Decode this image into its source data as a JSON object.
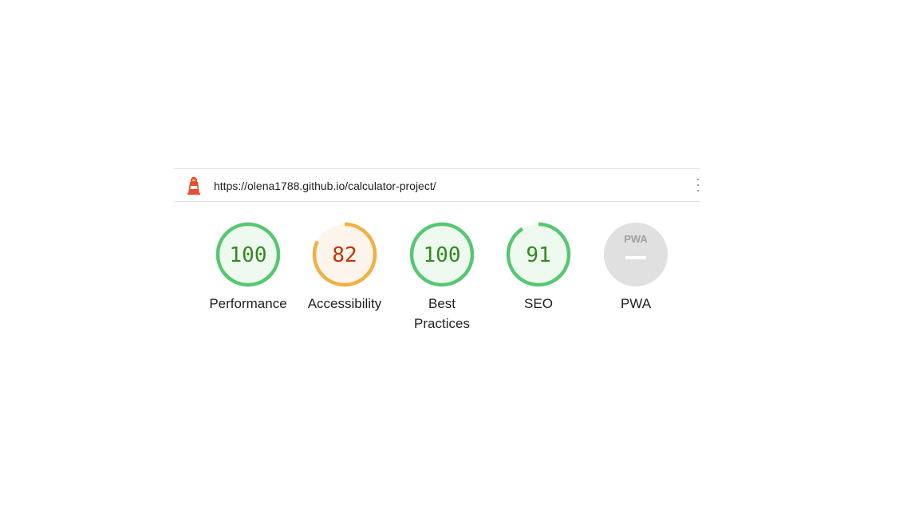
{
  "topbar": {
    "logo_icon": "lighthouse-icon",
    "url": "https://olena1788.github.io/calculator-project/",
    "menu_icon": "kebab-menu-icon"
  },
  "colors": {
    "pass": "#0cce6b",
    "pass_ring": "#56c772",
    "pass_fill": "#eef9f0",
    "pass_text": "#2f8a1c",
    "average_ring": "#f0b043",
    "average_fill": "#fdf5ec",
    "average_text": "#c33300",
    "na_fill": "#e0e0e0",
    "na_text": "#a0a0a0"
  },
  "gauges": [
    {
      "label": "Performance",
      "score": "100",
      "value": 100,
      "rating": "pass"
    },
    {
      "label": "Accessibility",
      "score": "82",
      "value": 82,
      "rating": "average"
    },
    {
      "label": "Best Practices",
      "score": "100",
      "value": 100,
      "rating": "pass"
    },
    {
      "label": "SEO",
      "score": "91",
      "value": 91,
      "rating": "pass"
    },
    {
      "label": "PWA",
      "badge": "PWA",
      "rating": "na",
      "icon": "pwa-badge-icon"
    }
  ]
}
